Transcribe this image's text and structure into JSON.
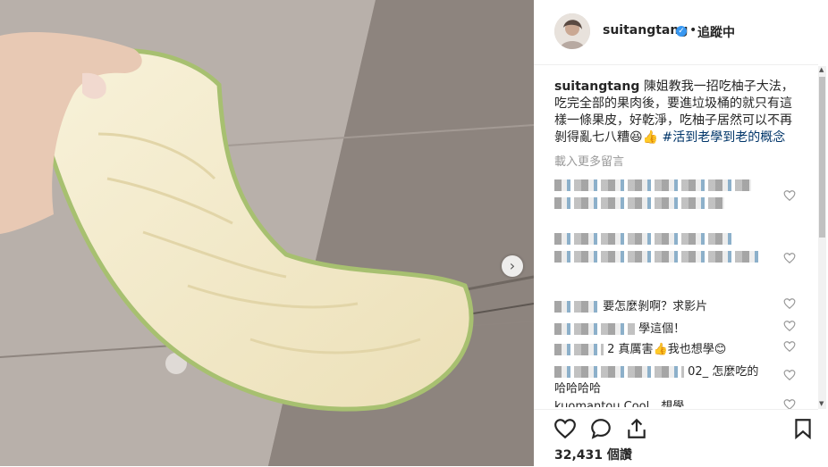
{
  "post": {
    "username": "suitangtang",
    "follow_label": "追蹤中",
    "separator": "•",
    "caption_user": "suitangtang",
    "caption_text": "陳姐教我一招吃柚子大法，吃完全部的果肉後，要進垃圾桶的就只有這樣一條果皮，好乾淨，吃柚子居然可以不再剝得亂七八糟😆👍",
    "caption_hashtag": "#活到老學到老的概念",
    "load_more": "載入更多留言",
    "likes": "32,431 個讚"
  },
  "comments": [
    {
      "text": "要怎麼剝啊？求影片"
    },
    {
      "text": "學這個！"
    },
    {
      "text": "2 真厲害👍我也想學😊"
    },
    {
      "text": "02_ 怎麼吃的"
    },
    {
      "text": "哈哈哈哈"
    },
    {
      "text": "kuomantou Cool，想學"
    }
  ],
  "colors": {
    "accent": "#3897f0",
    "text": "#262626",
    "muted": "#999999",
    "hashtag": "#003569"
  }
}
